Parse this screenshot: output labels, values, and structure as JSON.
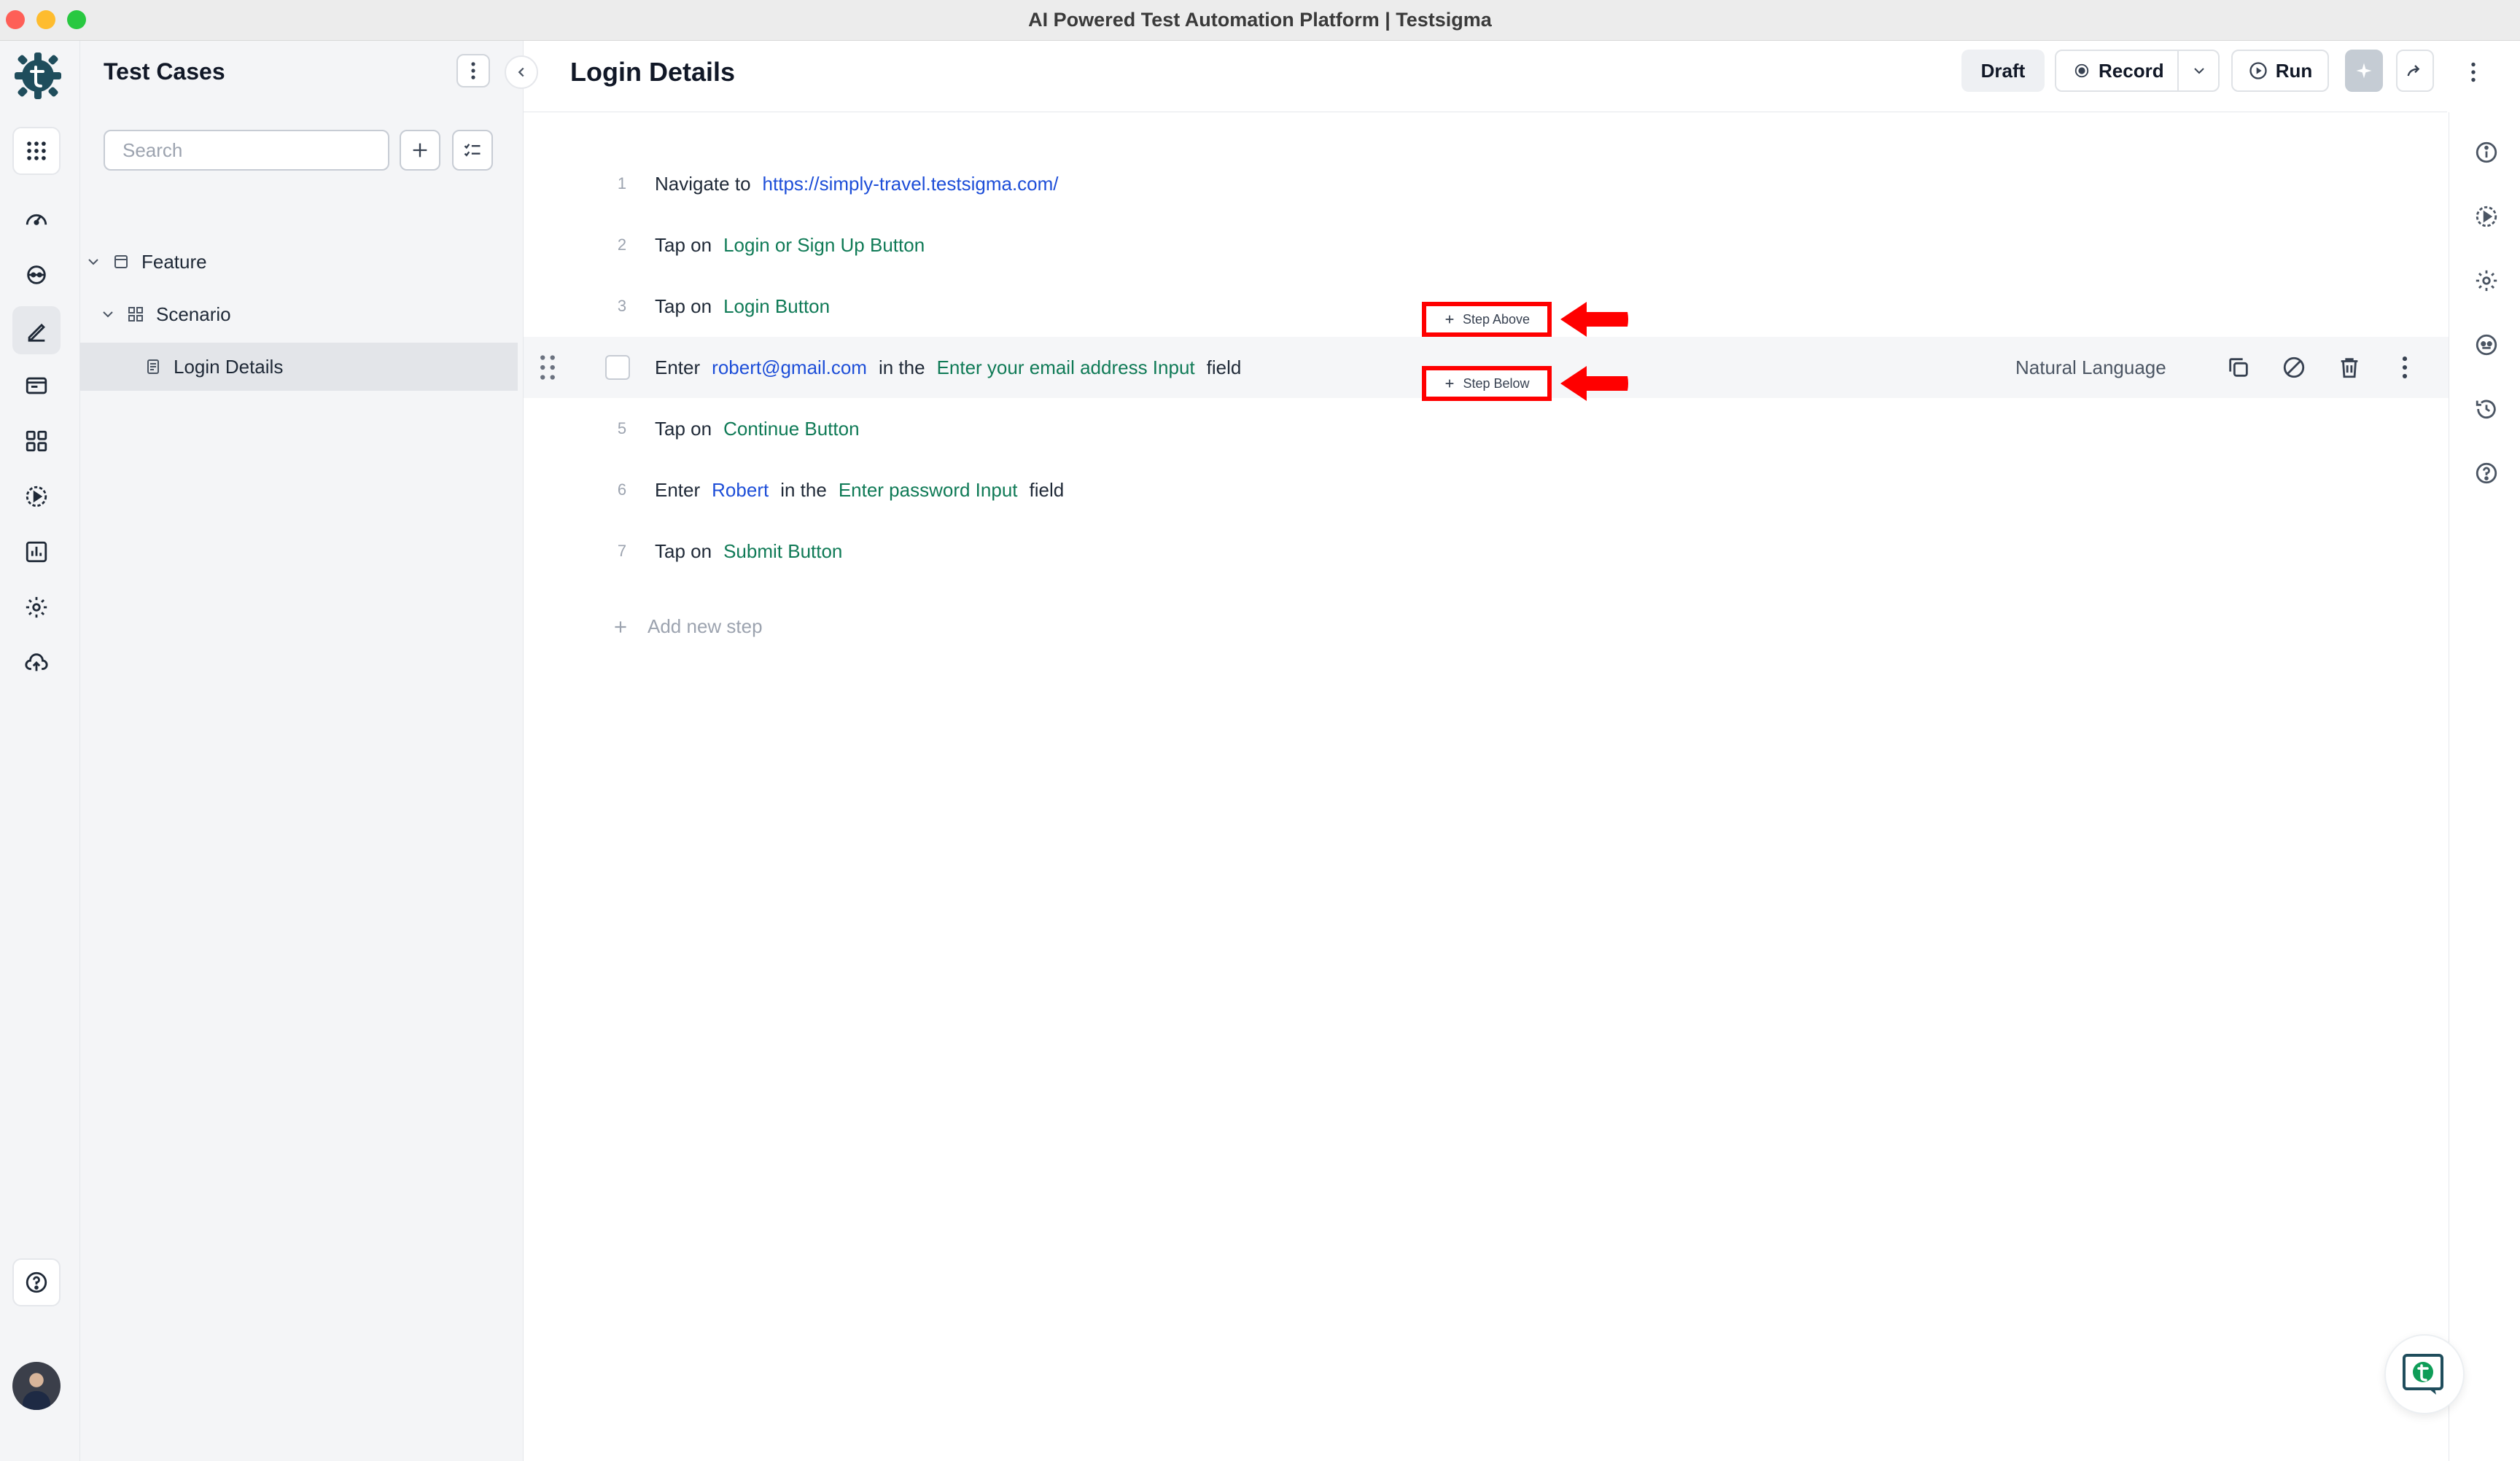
{
  "window": {
    "title": "AI Powered Test Automation Platform | Testsigma"
  },
  "rail": {
    "items": [
      "apps-icon",
      "dashboard-icon",
      "agent-icon",
      "test-cases-icon",
      "test-data-icon",
      "elements-icon",
      "runs-icon",
      "reports-icon",
      "settings-icon",
      "upload-icon"
    ],
    "active": "test-cases-icon",
    "help_icon": "help-icon"
  },
  "tree_panel": {
    "title": "Test Cases",
    "search_placeholder": "Search",
    "items": [
      {
        "label": "Feature",
        "level": 0,
        "icon": "feature-icon"
      },
      {
        "label": "Scenario",
        "level": 1,
        "icon": "scenario-icon"
      },
      {
        "label": "Login Details",
        "level": 2,
        "icon": "document-icon",
        "selected": true
      }
    ]
  },
  "header": {
    "title": "Login Details",
    "draft_label": "Draft",
    "record_label": "Record",
    "run_label": "Run"
  },
  "steps": [
    {
      "num": "1",
      "parts": [
        {
          "t": "Navigate to",
          "k": "kw"
        },
        {
          "t": "https://simply-travel.testsigma.com/",
          "k": "link"
        }
      ]
    },
    {
      "num": "2",
      "parts": [
        {
          "t": "Tap on",
          "k": "kw"
        },
        {
          "t": "Login or Sign Up Button",
          "k": "el"
        }
      ]
    },
    {
      "num": "3",
      "parts": [
        {
          "t": "Tap on",
          "k": "kw"
        },
        {
          "t": "Login Button",
          "k": "el"
        }
      ]
    },
    {
      "num": "",
      "parts": [
        {
          "t": "Enter",
          "k": "kw"
        },
        {
          "t": "robert@gmail.com",
          "k": "val"
        },
        {
          "t": "in the",
          "k": "kw"
        },
        {
          "t": "Enter your email address Input",
          "k": "el"
        },
        {
          "t": "field",
          "k": "kw"
        }
      ]
    },
    {
      "num": "5",
      "parts": [
        {
          "t": "Tap on",
          "k": "kw"
        },
        {
          "t": "Continue Button",
          "k": "el"
        }
      ]
    },
    {
      "num": "6",
      "parts": [
        {
          "t": "Enter",
          "k": "kw"
        },
        {
          "t": "Robert",
          "k": "val"
        },
        {
          "t": "in the",
          "k": "kw"
        },
        {
          "t": "Enter password Input",
          "k": "el"
        },
        {
          "t": "field",
          "k": "kw"
        }
      ]
    },
    {
      "num": "7",
      "parts": [
        {
          "t": "Tap on",
          "k": "kw"
        },
        {
          "t": "Submit Button",
          "k": "el"
        }
      ]
    }
  ],
  "hovered_step": {
    "mode_label": "Natural Language"
  },
  "add_step_label": "Add new step",
  "insert_buttons": {
    "above": "Step Above",
    "below": "Step Below"
  },
  "annotation_color": "#ff0000",
  "right_rail": [
    "info-icon",
    "run-history-icon",
    "settings-icon",
    "ai-agent-icon",
    "history-icon",
    "help-icon"
  ]
}
